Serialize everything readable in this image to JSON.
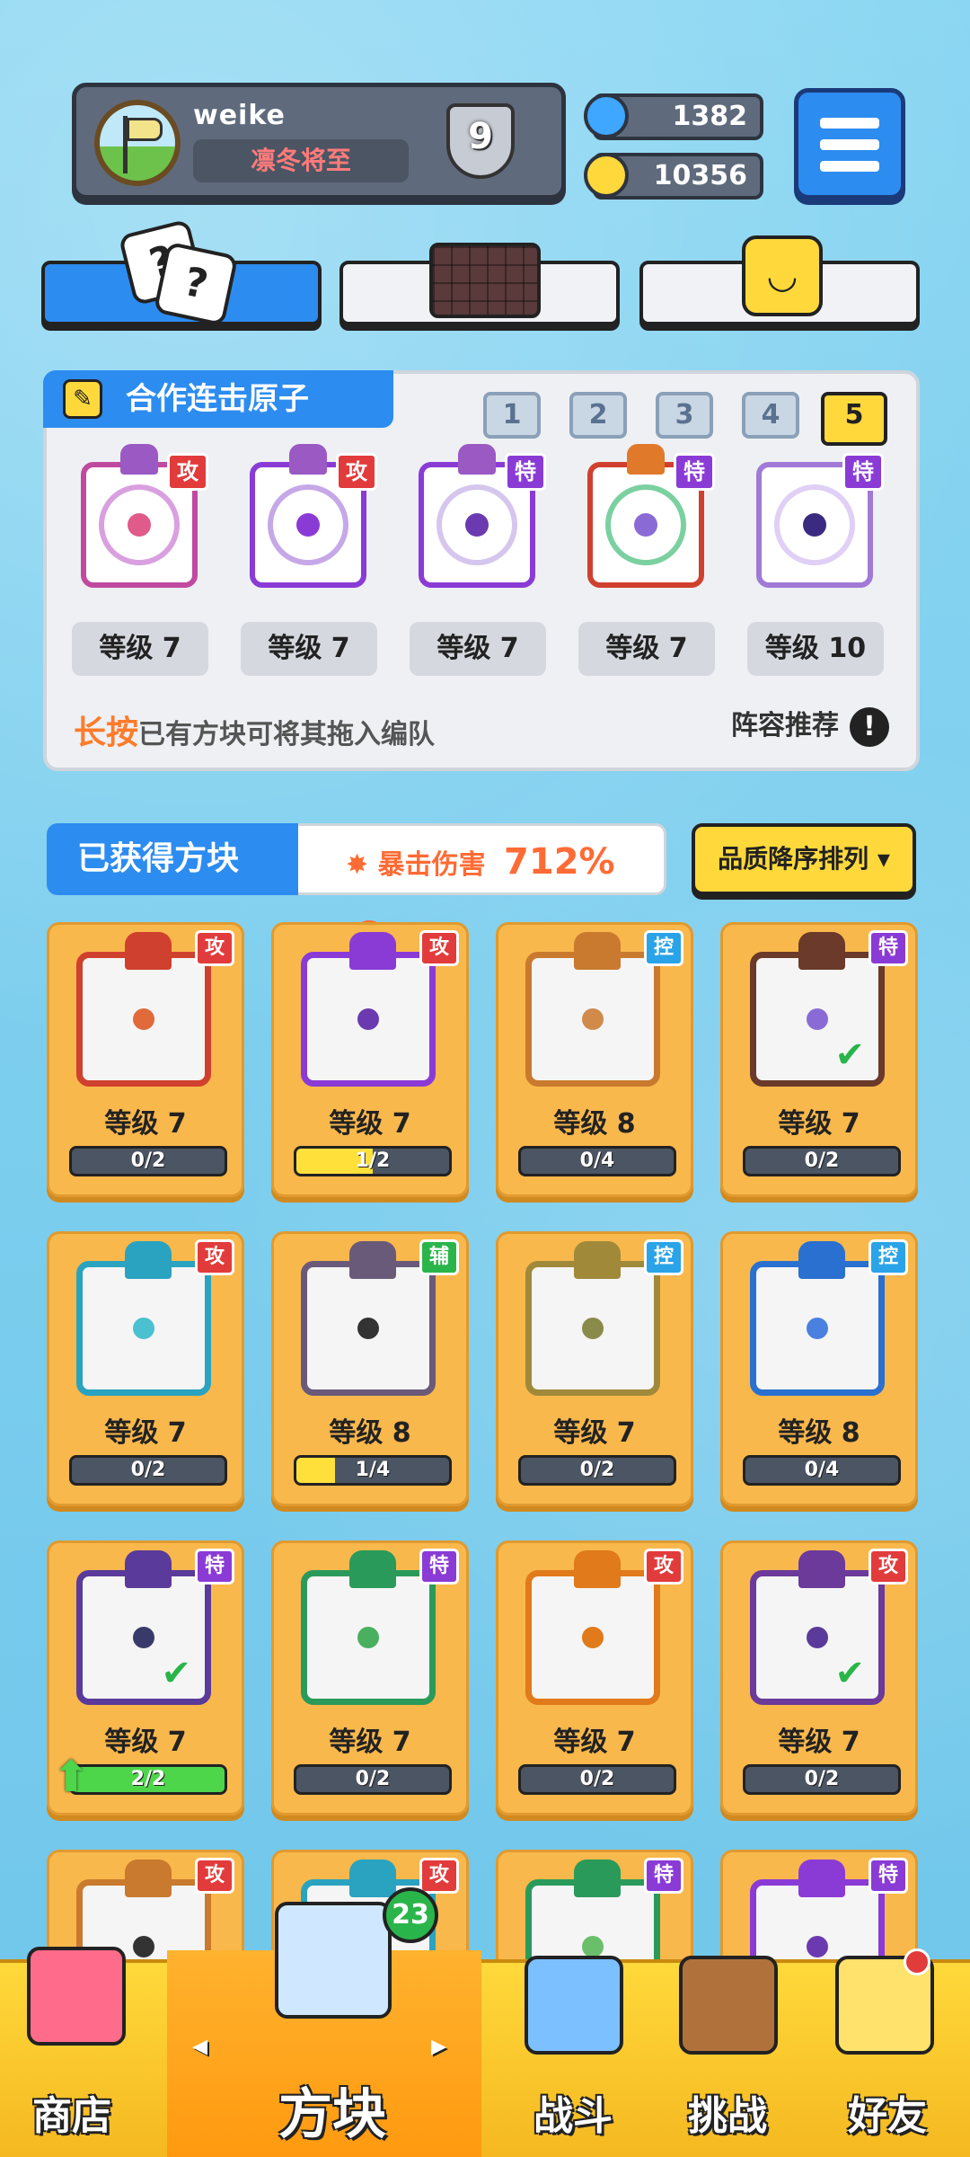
{
  "profile": {
    "name": "weike",
    "title": "凛冬将至",
    "rank": "9"
  },
  "currency": {
    "gems": "1382",
    "coins": "10356"
  },
  "combo": {
    "title": "合作连击原子",
    "pages": [
      "1",
      "2",
      "3",
      "4",
      "5"
    ],
    "slots": [
      {
        "type": "攻",
        "level": "等级 7"
      },
      {
        "type": "攻",
        "level": "等级 7"
      },
      {
        "type": "特",
        "level": "等级 7"
      },
      {
        "type": "特",
        "level": "等级 7"
      },
      {
        "type": "特",
        "level": "等级 10"
      }
    ],
    "hint_highlight": "长按",
    "hint_rest": "已有方块可将其拖入编队",
    "recommend": "阵容推荐"
  },
  "obtained": {
    "title": "已获得方块",
    "crit_label": "暴击伤害",
    "crit_value": "712%",
    "sort_label": "品质降序排列"
  },
  "cards": [
    {
      "type": "攻",
      "level": "等级 7",
      "progress": "0/2"
    },
    {
      "type": "攻",
      "level": "等级 7",
      "progress": "1/2"
    },
    {
      "type": "控",
      "level": "等级 8",
      "progress": "0/4"
    },
    {
      "type": "特",
      "level": "等级 7",
      "progress": "0/2"
    },
    {
      "type": "攻",
      "level": "等级 7",
      "progress": "0/2"
    },
    {
      "type": "辅",
      "level": "等级 8",
      "progress": "1/4"
    },
    {
      "type": "控",
      "level": "等级 7",
      "progress": "0/2"
    },
    {
      "type": "控",
      "level": "等级 8",
      "progress": "0/4"
    },
    {
      "type": "特",
      "level": "等级 7",
      "progress": "2/2"
    },
    {
      "type": "特",
      "level": "等级 7",
      "progress": "0/2"
    },
    {
      "type": "攻",
      "level": "等级 7",
      "progress": "0/2"
    },
    {
      "type": "攻",
      "level": "等级 7",
      "progress": "0/2"
    },
    {
      "type": "攻",
      "level": ""
    },
    {
      "type": "攻",
      "level": ""
    },
    {
      "type": "特",
      "level": ""
    },
    {
      "type": "特",
      "level": ""
    }
  ],
  "nav": {
    "shop": "商店",
    "blocks": "方块",
    "battle": "战斗",
    "challenge": "挑战",
    "friends": "好友",
    "blocks_badge": "23"
  },
  "colors": {
    "attack": "#e23b3b",
    "special": "#8a3bd6",
    "control": "#2aa3e8",
    "support": "#2ab54a",
    "accent": "#2d8cf0",
    "gold": "#ffd93b"
  }
}
